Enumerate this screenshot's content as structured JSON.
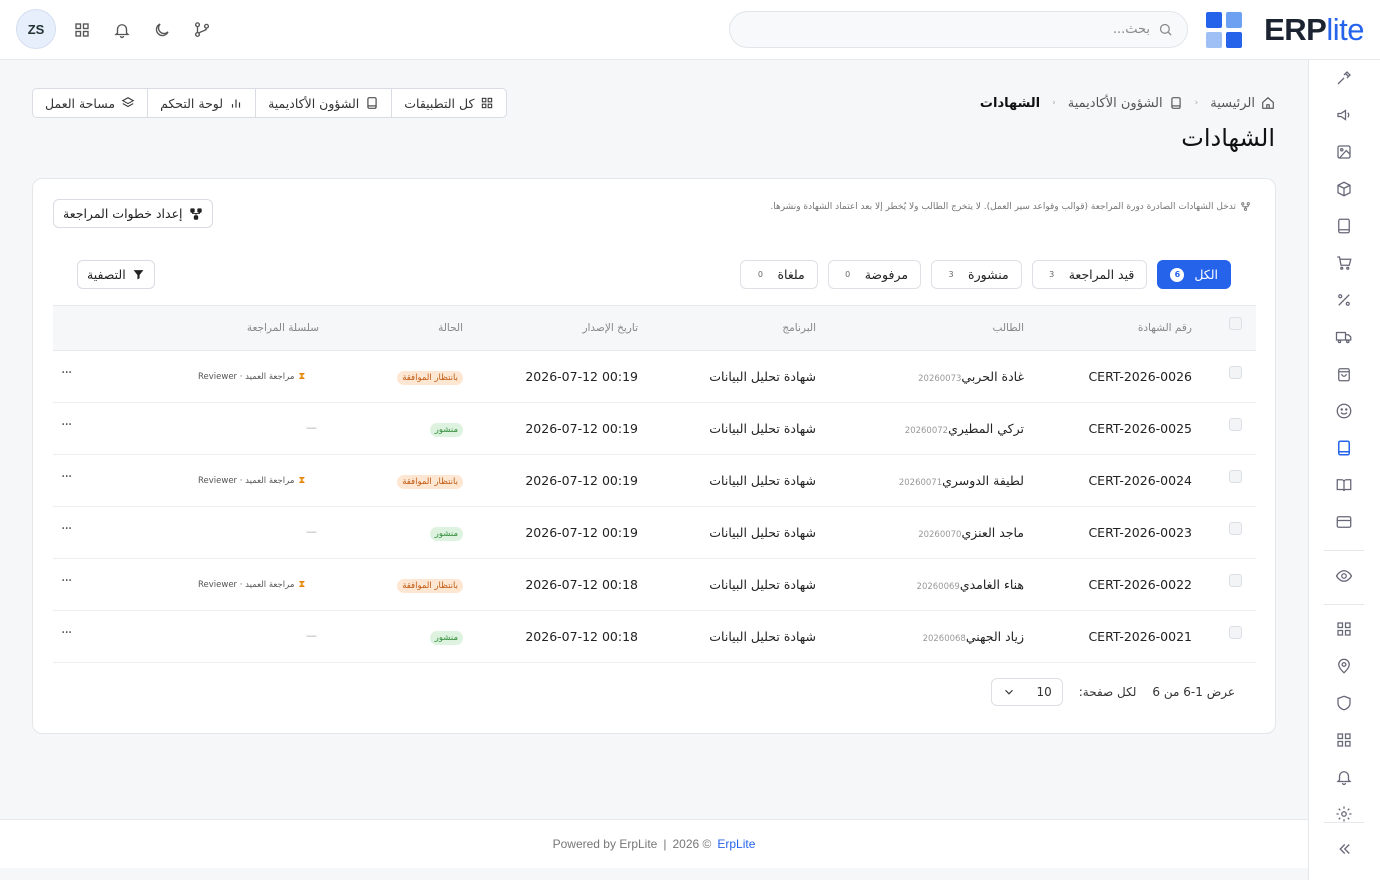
{
  "brand": {
    "name_bold": "ERP",
    "name_light": "lite",
    "colors": [
      "#2563eb",
      "#2f7bf0",
      "#9ec0f5",
      "#3b6fe0"
    ]
  },
  "header": {
    "search_placeholder": "بحث...",
    "avatar_initials": "ZS",
    "icons": [
      "apps-icon",
      "bell-icon",
      "moon-icon",
      "git-branch-icon"
    ]
  },
  "breadcrumb": {
    "home": "الرئيسية",
    "section": "الشؤون الأكاديمية",
    "current": "الشهادات"
  },
  "page_title": "الشهادات",
  "quick_links": {
    "all_apps": "كل التطبيقات",
    "academic": "الشؤون الأكاديمية",
    "dashboard": "لوحة التحكم",
    "workspace": "مساحة العمل"
  },
  "card": {
    "notice": "تدخل الشهادات الصادرة دورة المراجعة (قوالب وقواعد سير العمل). لا يتخرج الطالب ولا يُخطر إلا بعد اعتماد الشهادة ونشرها.",
    "setup_button": "إعداد خطوات المراجعة",
    "filter_button": "التصفية",
    "tabs": [
      {
        "label": "الكل",
        "count": "6",
        "active": true
      },
      {
        "label": "قيد المراجعة",
        "count": "3",
        "active": false
      },
      {
        "label": "منشورة",
        "count": "3",
        "active": false
      },
      {
        "label": "مرفوضة",
        "count": "0",
        "active": false
      },
      {
        "label": "ملغاة",
        "count": "0",
        "active": false
      }
    ]
  },
  "table": {
    "headers": {
      "cert_no": "رقم الشهادة",
      "student": "الطالب",
      "program": "البرنامج",
      "issue_date": "تاريخ الإصدار",
      "status": "الحالة",
      "chain": "سلسلة المراجعة"
    },
    "rows": [
      {
        "cert_no": "CERT-2026-0026",
        "student": "غادة الحربي",
        "student_id": "20260073",
        "program": "شهادة تحليل البيانات",
        "issue_date": "2026-07-12 00:19",
        "status": "بانتظار الموافقة",
        "status_type": "pending",
        "chain": "مراجعة العميد · Reviewer"
      },
      {
        "cert_no": "CERT-2026-0025",
        "student": "تركي المطيري",
        "student_id": "20260072",
        "program": "شهادة تحليل البيانات",
        "issue_date": "2026-07-12 00:19",
        "status": "منشور",
        "status_type": "published",
        "chain": "—"
      },
      {
        "cert_no": "CERT-2026-0024",
        "student": "لطيفة الدوسري",
        "student_id": "20260071",
        "program": "شهادة تحليل البيانات",
        "issue_date": "2026-07-12 00:19",
        "status": "بانتظار الموافقة",
        "status_type": "pending",
        "chain": "مراجعة العميد · Reviewer"
      },
      {
        "cert_no": "CERT-2026-0023",
        "student": "ماجد العنزي",
        "student_id": "20260070",
        "program": "شهادة تحليل البيانات",
        "issue_date": "2026-07-12 00:19",
        "status": "منشور",
        "status_type": "published",
        "chain": "—"
      },
      {
        "cert_no": "CERT-2026-0022",
        "student": "هناء الغامدي",
        "student_id": "20260069",
        "program": "شهادة تحليل البيانات",
        "issue_date": "2026-07-12 00:18",
        "status": "بانتظار الموافقة",
        "status_type": "pending",
        "chain": "مراجعة العميد · Reviewer"
      },
      {
        "cert_no": "CERT-2026-0021",
        "student": "زياد الجهني",
        "student_id": "20260068",
        "program": "شهادة تحليل البيانات",
        "issue_date": "2026-07-12 00:18",
        "status": "منشور",
        "status_type": "published",
        "chain": "—"
      }
    ]
  },
  "pagination": {
    "showing_label": "عرض",
    "range": "1-6",
    "of_label": "من",
    "total": "6",
    "per_page_label": "لكل صفحة:",
    "per_page_value": "10"
  },
  "footer": {
    "powered": "Powered by ErpLite",
    "separator": "|",
    "copyright": "2026 ©",
    "link": "ErpLite"
  },
  "sidebar_icons": [
    "tools-icon",
    "megaphone-icon",
    "image-icon",
    "box-icon",
    "book-icon",
    "cart-icon",
    "percent-icon",
    "truck-icon",
    "bag-icon",
    "smile-icon",
    "academic-book-icon",
    "book-open-icon",
    "credit-card-icon",
    "eye-icon",
    "grid-icon",
    "location-icon",
    "shield-icon",
    "apps-grid-icon",
    "bell-icon",
    "settings-icon",
    "collapse-icon"
  ]
}
